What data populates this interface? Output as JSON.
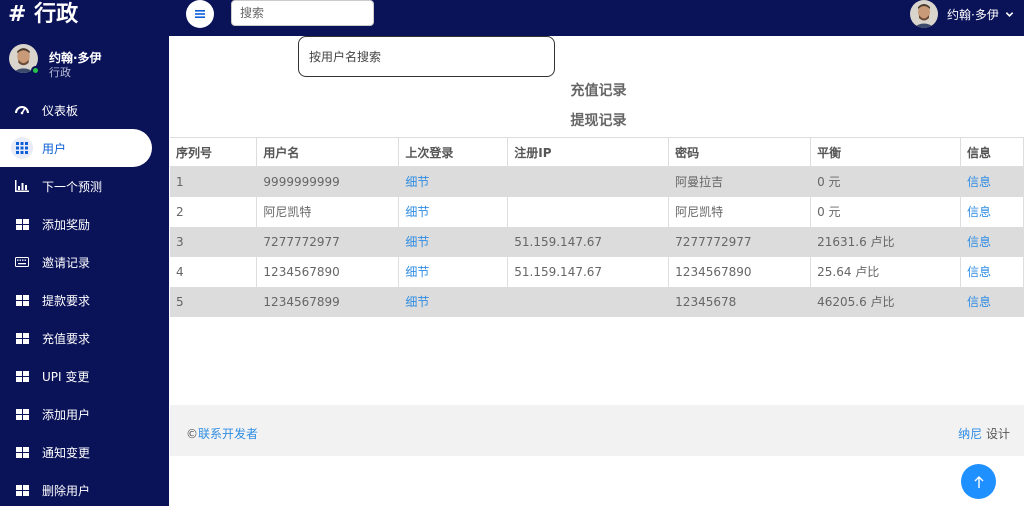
{
  "header": {
    "brand": "# 行政",
    "search_placeholder": "搜索",
    "user_name": "约翰·多伊"
  },
  "sidebar": {
    "profile": {
      "name": "约翰·多伊",
      "role": "行政"
    },
    "items": [
      {
        "label": "仪表板",
        "icon": "dashboard-icon",
        "active": false
      },
      {
        "label": "用户",
        "icon": "grid-icon",
        "active": true
      },
      {
        "label": "下一个预测",
        "icon": "bar-chart-icon",
        "active": false
      },
      {
        "label": "添加奖励",
        "icon": "table-icon",
        "active": false
      },
      {
        "label": "邀请记录",
        "icon": "keyboard-icon",
        "active": false
      },
      {
        "label": "提款要求",
        "icon": "table-icon",
        "active": false
      },
      {
        "label": "充值要求",
        "icon": "table-icon",
        "active": false
      },
      {
        "label": "UPI 变更",
        "icon": "table-icon",
        "active": false
      },
      {
        "label": "添加用户",
        "icon": "table-icon",
        "active": false
      },
      {
        "label": "通知变更",
        "icon": "table-icon",
        "active": false
      },
      {
        "label": "删除用户",
        "icon": "table-icon",
        "active": false
      }
    ]
  },
  "main": {
    "search_placeholder": "按用户名搜索",
    "link_recharge": "充值记录",
    "link_withdraw": "提现记录",
    "table": {
      "columns": [
        "序列号",
        "用户名",
        "上次登录",
        "注册IP",
        "密码",
        "平衡",
        "信息"
      ],
      "rows": [
        {
          "serial": "1",
          "username": "9999999999",
          "last_login": "细节",
          "ip": "",
          "password": "阿曼拉吉",
          "balance": "0 元",
          "info": "信息"
        },
        {
          "serial": "2",
          "username": "阿尼凯特",
          "last_login": "细节",
          "ip": "",
          "password": "阿尼凯特",
          "balance": "0 元",
          "info": "信息"
        },
        {
          "serial": "3",
          "username": "7277772977",
          "last_login": "细节",
          "ip": "51.159.147.67",
          "password": "7277772977",
          "balance": "21631.6 卢比",
          "info": "信息"
        },
        {
          "serial": "4",
          "username": "1234567890",
          "last_login": "细节",
          "ip": "51.159.147.67",
          "password": "1234567890",
          "balance": "25.64 卢比",
          "info": "信息"
        },
        {
          "serial": "5",
          "username": "1234567899",
          "last_login": "细节",
          "ip": "",
          "password": "12345678",
          "balance": "46205.6 卢比",
          "info": "信息"
        }
      ]
    }
  },
  "footer": {
    "copyright": "©",
    "contact_link": "联系开发者",
    "designer_link": "纳尼",
    "design_label": " 设计"
  },
  "colors": {
    "navy": "#0a1258",
    "link_blue": "#2f8de4",
    "active_blue": "#0b5ed7",
    "online_green": "#27c24c"
  }
}
